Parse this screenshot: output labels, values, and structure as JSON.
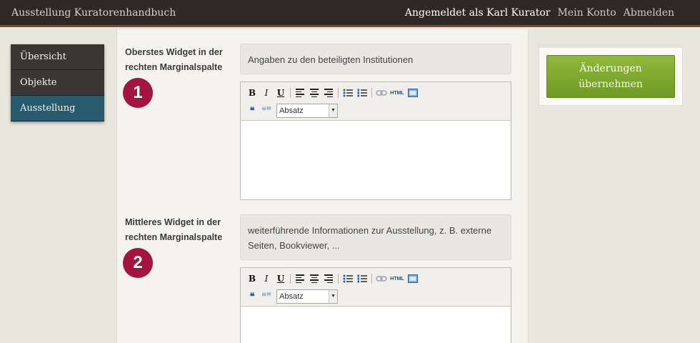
{
  "header": {
    "title": "Ausstellung Kuratorenhandbuch",
    "logged_in": "Angemeldet als Karl Kurator",
    "account_link": "Mein Konto",
    "logout_link": "Abmelden"
  },
  "sidebar": {
    "items": [
      {
        "label": "Übersicht",
        "active": false
      },
      {
        "label": "Objekte",
        "active": false
      },
      {
        "label": "Ausstellung",
        "active": true
      }
    ]
  },
  "widgets": [
    {
      "label_line1": "Oberstes Widget in der",
      "label_line2": "rechten Marginalspalte",
      "badge": "1",
      "hint": "Angaben zu den beteiligten Institutionen",
      "format": "Absatz"
    },
    {
      "label_line1": "Mittleres Widget in der",
      "label_line2": "rechten Marginalspalte",
      "badge": "2",
      "hint_line1": "weiterführende Informationen zur Ausstellung, z. B. externe",
      "hint_line2": "Seiten, Bookviewer, ...",
      "format": "Absatz"
    }
  ],
  "toolbar": {
    "bold": "B",
    "italic": "I",
    "underline": "U",
    "html": "HTML"
  },
  "actions": {
    "apply_line1": "Änderungen",
    "apply_line2": "übernehmen"
  },
  "colors": {
    "badge": "#a3143e",
    "active_nav": "#285a6e",
    "apply_button": "#7ea82e"
  }
}
